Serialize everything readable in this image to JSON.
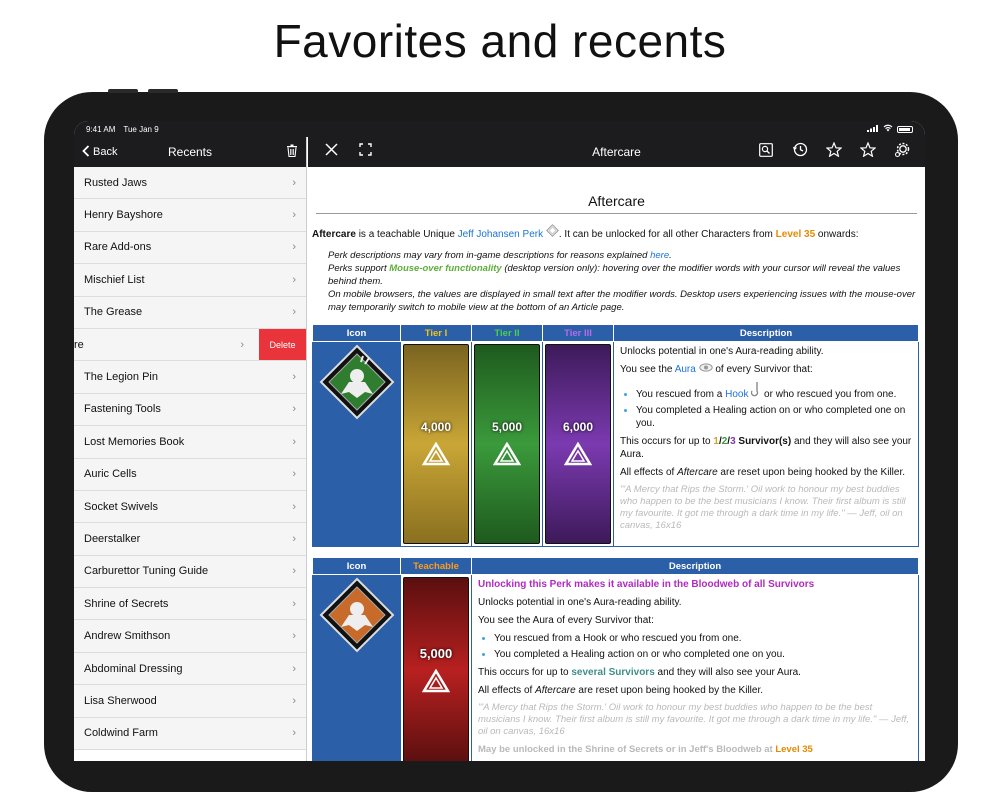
{
  "headline": "Favorites and recents",
  "status": {
    "time": "9:41 AM",
    "date": "Tue Jan 9"
  },
  "sidebar": {
    "back_label": "Back",
    "title": "Recents",
    "items": [
      {
        "label": "Rusted Jaws"
      },
      {
        "label": "Henry Bayshore"
      },
      {
        "label": "Rare Add-ons"
      },
      {
        "label": "Mischief List"
      },
      {
        "label": "The Grease"
      },
      {
        "label": "re",
        "swiped": true
      },
      {
        "label": "The Legion Pin"
      },
      {
        "label": "Fastening Tools"
      },
      {
        "label": "Lost Memories Book"
      },
      {
        "label": "Auric Cells"
      },
      {
        "label": "Socket Swivels"
      },
      {
        "label": "Deerstalker"
      },
      {
        "label": "Carburettor Tuning Guide"
      },
      {
        "label": "Shrine of Secrets"
      },
      {
        "label": "Andrew Smithson"
      },
      {
        "label": "Abdominal Dressing"
      },
      {
        "label": "Lisa Sherwood"
      },
      {
        "label": "Coldwind Farm"
      }
    ],
    "delete_label": "Delete"
  },
  "main": {
    "title": "Aftercare",
    "page_title": "Aftercare",
    "intro": {
      "name": "Aftercare",
      "t1": " is a teachable Unique ",
      "link": "Jeff Johansen Perk",
      "t2": ". It can be unlocked for all other Characters from ",
      "level": "Level 35",
      "t3": " onwards:"
    },
    "notes": {
      "n1a": "Perk descriptions may vary from in-game descriptions for reasons explained ",
      "n1link": "here",
      "n1b": ".",
      "n2a": "Perks support ",
      "n2hl": "Mouse-over functionality",
      "n2b": " (desktop version only): hovering over the modifier words with your cursor will reveal the values behind them.",
      "n3": "On mobile browsers, the values are displayed in small text after the modifier words. Desktop users experiencing issues with the mouse-over may temporarily switch to mobile view at the bottom of an Article page."
    },
    "table1": {
      "headers": {
        "icon": "Icon",
        "t1": "Tier I",
        "t2": "Tier II",
        "t3": "Tier III",
        "desc": "Description"
      },
      "tiers": [
        "4,000",
        "5,000",
        "6,000"
      ],
      "desc": {
        "p1": "Unlocks potential in one's Aura-reading ability.",
        "p2a": "You see the ",
        "p2link": "Aura",
        "p2b": " of every Survivor that:",
        "li1a": "You rescued from a ",
        "li1link": "Hook",
        "li1b": " or who rescued you from one.",
        "li2": "You completed a Healing action on or who completed one on you.",
        "p3a": "This occurs for up to ",
        "p3v1": "1",
        "p3s1": "/",
        "p3v2": "2",
        "p3s2": "/",
        "p3v3": "3",
        "p3b": " Survivor(s)",
        "p3c": " and they will also see your Aura.",
        "p4a": "All effects of ",
        "p4i": "Aftercare",
        "p4b": " are reset upon being hooked by the Killer.",
        "quote": "\"'A Mercy that Rips the Storm.' Oil work to honour my best buddies who happen to be the best musicians I know. Their first album is still my favourite. It got me through a dark time in my life.\" — Jeff, oil on canvas, 16x16"
      }
    },
    "table2": {
      "headers": {
        "icon": "Icon",
        "teach": "Teachable",
        "desc": "Description"
      },
      "tier": "5,000",
      "desc": {
        "hl": "Unlocking this Perk makes it available in the Bloodweb of all Survivors",
        "p1": "Unlocks potential in one's Aura-reading ability.",
        "p2": "You see the Aura of every Survivor that:",
        "li1": "You rescued from a Hook or who rescued you from one.",
        "li2": "You completed a Healing action on or who completed one on you.",
        "p3a": "This occurs for up to ",
        "p3hl": "several Survivors",
        "p3b": " and they will also see your Aura.",
        "p4a": "All effects of ",
        "p4i": "Aftercare",
        "p4b": " are reset upon being hooked by the Killer.",
        "quote": "\"'A Mercy that Rips the Storm.' Oil work to honour my best buddies who happen to be the best musicians I know. Their first album is still my favourite. It got me through a dark time in my life.\" — Jeff, oil on canvas, 16x16",
        "footer_a": "May be unlocked in the Shrine of Secrets or in Jeff's Bloodweb at ",
        "footer_level": "Level 35"
      }
    }
  }
}
